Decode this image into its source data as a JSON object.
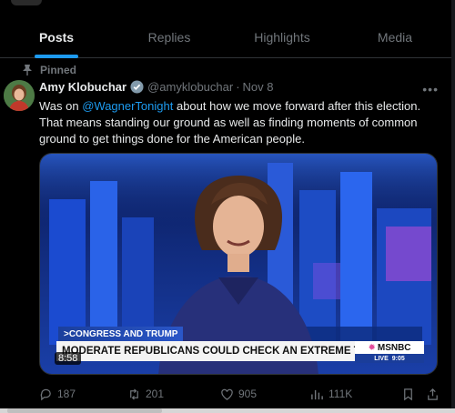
{
  "tabs": [
    {
      "label": "Posts",
      "active": true
    },
    {
      "label": "Replies",
      "active": false
    },
    {
      "label": "Highlights",
      "active": false
    },
    {
      "label": "Media",
      "active": false
    }
  ],
  "tweet": {
    "pinned_label": "Pinned",
    "author_name": "Amy Klobuchar",
    "handle": "@amyklobuchar",
    "separator": "·",
    "date": "Nov 8",
    "text_prefix": "Was on ",
    "mention": "@WagnerTonight",
    "text_suffix": " about how we move forward after this election. That means standing our ground as well as finding moments of common ground to get things done for the American people.",
    "media": {
      "ticker_top": ">CONGRESS AND TRUMP",
      "ticker_main": "MODERATE REPUBLICANS COULD CHECK AN EXTREME TRUMP AGENDA",
      "network": "MSNBC",
      "live_label": "LIVE",
      "live_time": "9:05",
      "duration": "8:58"
    },
    "stats": {
      "replies": "187",
      "reposts": "201",
      "likes": "905",
      "views": "111K"
    }
  },
  "colors": {
    "accent": "#1d9bf0",
    "background": "#000000",
    "muted": "#71767b"
  },
  "icons": [
    "pin-icon",
    "verified-icon",
    "more-icon",
    "reply-icon",
    "repost-icon",
    "like-icon",
    "views-icon",
    "bookmark-icon",
    "share-icon"
  ]
}
